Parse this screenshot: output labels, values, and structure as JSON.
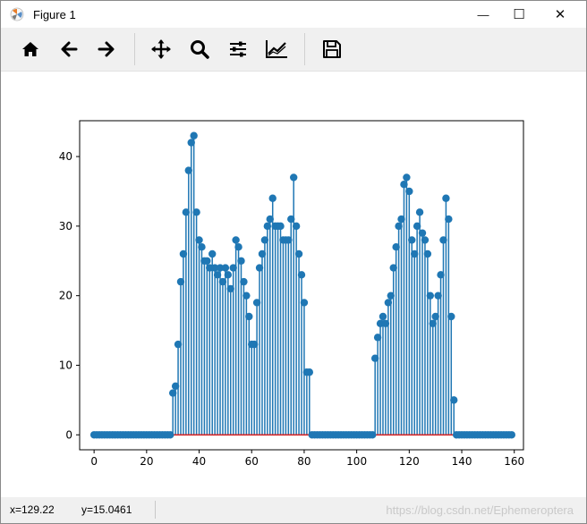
{
  "window": {
    "title": "Figure 1",
    "minimize_glyph": "—",
    "maximize_glyph": "☐",
    "close_glyph": "✕"
  },
  "toolbar": {
    "buttons": [
      {
        "name": "home-button",
        "icon": "home-icon"
      },
      {
        "name": "back-button",
        "icon": "arrow-left-icon"
      },
      {
        "name": "forward-button",
        "icon": "arrow-right-icon"
      },
      {
        "name": "pan-button",
        "icon": "move-icon"
      },
      {
        "name": "zoom-button",
        "icon": "magnifier-icon"
      },
      {
        "name": "subplots-button",
        "icon": "sliders-icon"
      },
      {
        "name": "axes-edit-button",
        "icon": "line-chart-icon"
      },
      {
        "name": "save-button",
        "icon": "floppy-disk-icon"
      }
    ]
  },
  "status": {
    "x_readout": "x=129.22",
    "y_readout": "y=15.0461",
    "watermark": "https://blog.csdn.net/Ephemeroptera"
  },
  "colors": {
    "stem": "#1f77b4",
    "baseline": "#d62728",
    "toolbar_bg": "#f0f0f0"
  },
  "chart_data": {
    "type": "stem",
    "title": "",
    "xlabel": "",
    "ylabel": "",
    "xlim": [
      -5.5,
      163.5
    ],
    "ylim": [
      -2.15,
      45.15
    ],
    "xticks": [
      0,
      20,
      40,
      60,
      80,
      100,
      120,
      140,
      160
    ],
    "yticks": [
      0,
      10,
      20,
      30,
      40
    ],
    "grid": false,
    "baseline": 0,
    "x": [
      0,
      1,
      2,
      3,
      4,
      5,
      6,
      7,
      8,
      9,
      10,
      11,
      12,
      13,
      14,
      15,
      16,
      17,
      18,
      19,
      20,
      21,
      22,
      23,
      24,
      25,
      26,
      27,
      28,
      29,
      30,
      31,
      32,
      33,
      34,
      35,
      36,
      37,
      38,
      39,
      40,
      41,
      42,
      43,
      44,
      45,
      46,
      47,
      48,
      49,
      50,
      51,
      52,
      53,
      54,
      55,
      56,
      57,
      58,
      59,
      60,
      61,
      62,
      63,
      64,
      65,
      66,
      67,
      68,
      69,
      70,
      71,
      72,
      73,
      74,
      75,
      76,
      77,
      78,
      79,
      80,
      81,
      82,
      83,
      84,
      85,
      86,
      87,
      88,
      89,
      90,
      91,
      92,
      93,
      94,
      95,
      96,
      97,
      98,
      99,
      100,
      101,
      102,
      103,
      104,
      105,
      106,
      107,
      108,
      109,
      110,
      111,
      112,
      113,
      114,
      115,
      116,
      117,
      118,
      119,
      120,
      121,
      122,
      123,
      124,
      125,
      126,
      127,
      128,
      129,
      130,
      131,
      132,
      133,
      134,
      135,
      136,
      137,
      138,
      139,
      140,
      141,
      142,
      143,
      144,
      145,
      146,
      147,
      148,
      149,
      150,
      151,
      152,
      153,
      154,
      155,
      156,
      157,
      158,
      159
    ],
    "y": [
      0,
      0,
      0,
      0,
      0,
      0,
      0,
      0,
      0,
      0,
      0,
      0,
      0,
      0,
      0,
      0,
      0,
      0,
      0,
      0,
      0,
      0,
      0,
      0,
      0,
      0,
      0,
      0,
      0,
      0,
      6,
      7,
      13,
      22,
      26,
      32,
      38,
      42,
      43,
      32,
      28,
      27,
      25,
      25,
      24,
      26,
      24,
      23,
      24,
      22,
      24,
      23,
      21,
      24,
      28,
      27,
      25,
      22,
      20,
      17,
      13,
      13,
      19,
      24,
      26,
      28,
      30,
      31,
      34,
      30,
      30,
      30,
      28,
      28,
      28,
      31,
      37,
      30,
      26,
      23,
      19,
      9,
      9,
      0,
      0,
      0,
      0,
      0,
      0,
      0,
      0,
      0,
      0,
      0,
      0,
      0,
      0,
      0,
      0,
      0,
      0,
      0,
      0,
      0,
      0,
      0,
      0,
      11,
      14,
      16,
      17,
      16,
      19,
      20,
      24,
      27,
      30,
      31,
      36,
      37,
      35,
      28,
      26,
      30,
      32,
      29,
      28,
      26,
      20,
      16,
      17,
      20,
      23,
      28,
      34,
      31,
      17,
      5,
      0,
      0,
      0,
      0,
      0,
      0,
      0,
      0,
      0,
      0,
      0,
      0,
      0,
      0,
      0,
      0,
      0,
      0,
      0,
      0,
      0,
      0
    ]
  }
}
